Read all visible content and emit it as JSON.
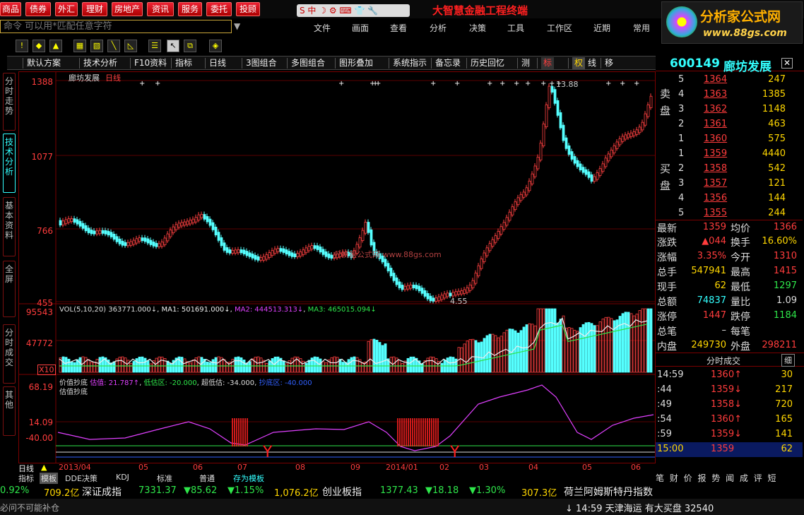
{
  "menu": {
    "buttons": [
      "商品",
      "债券",
      "外汇",
      "理财",
      "房地产",
      "资讯",
      "服务",
      "委托",
      "投顾"
    ],
    "title": "大智慧金融工程终端"
  },
  "cmd": {
    "text": "命令    可以用*匹配任意字符",
    "items": [
      "文件",
      "画面",
      "查看",
      "分析",
      "决策",
      "工具",
      "工作区",
      "近期",
      "常用"
    ]
  },
  "logo": {
    "name": "分析家公式网",
    "url": "www.88gs.com"
  },
  "tabs": [
    "默认方案",
    "技术分析",
    "F10资料",
    "指标",
    "日线",
    "3图组合",
    "多图组合",
    "图形叠加",
    "系统指示",
    "备忘录",
    "历史回忆",
    "测",
    "标",
    "权",
    "线",
    "移"
  ],
  "sidebar": [
    "分时走势",
    "技术分析",
    "基本资料",
    "全屏",
    "分时成交",
    "其他"
  ],
  "main_chart": {
    "title": "廊坊发展",
    "period": "日线",
    "watermark": "分析家公式网 www.88gs.com",
    "y_labels": [
      "1388",
      "1077",
      "766",
      "455"
    ],
    "high_note": "13.88",
    "low_note": "4.55"
  },
  "vol": {
    "header": "VOL(5,10,20)",
    "vol": "363771.000↓",
    "ma1": "MA1: 501691.000↓",
    "ma2": "MA2: 444513.313↓",
    "ma3": "MA3: 465015.094↓",
    "y_labels": [
      "95543",
      "47772"
    ],
    "unit": "X10"
  },
  "ind": {
    "name": "价值抄底",
    "sub": "估值抄底",
    "l1": "估值: 21.787↑",
    "l2": "低估区: -20.000",
    "l3": "超低估: -34.000",
    "l4": "抄底区: -40.000",
    "y_labels": [
      "68.19",
      "14.09",
      "-40.00"
    ]
  },
  "xaxis": {
    "period": "日线",
    "labels": [
      "2013/04",
      "05",
      "06",
      "07",
      "08",
      "09",
      "2014/01",
      "02",
      "03",
      "04",
      "05",
      "06"
    ]
  },
  "quote": {
    "code": "600149",
    "name": "廊坊发展",
    "asks": [
      [
        "5",
        "1364",
        "247"
      ],
      [
        "4",
        "1363",
        "1385"
      ],
      [
        "3",
        "1362",
        "1148"
      ],
      [
        "2",
        "1361",
        "463"
      ],
      [
        "1",
        "1360",
        "575"
      ]
    ],
    "bids": [
      [
        "1",
        "1359",
        "4440"
      ],
      [
        "2",
        "1358",
        "542"
      ],
      [
        "3",
        "1357",
        "121"
      ],
      [
        "4",
        "1356",
        "144"
      ],
      [
        "5",
        "1355",
        "244"
      ]
    ],
    "ask_label": "卖盘",
    "bid_label": "买盘",
    "stats": [
      [
        "最新",
        "1359",
        "均价",
        "1366"
      ],
      [
        "涨跌",
        "▲044",
        "换手",
        "16.60%"
      ],
      [
        "涨幅",
        "3.35%",
        "今开",
        "1310"
      ],
      [
        "总手",
        "547941",
        "最高",
        "1415"
      ],
      [
        "现手",
        "62",
        "最低",
        "1297"
      ],
      [
        "总额",
        "74837",
        "量比",
        "1.09"
      ],
      [
        "涨停",
        "1447",
        "跌停",
        "1184"
      ],
      [
        "总笔",
        "–",
        "每笔",
        ""
      ],
      [
        "内盘",
        "249730",
        "外盘",
        "298211"
      ]
    ],
    "ticks_title": "分时成交",
    "ticks_btn": "细",
    "ticks": [
      [
        "14:59",
        "1360↑",
        "30"
      ],
      [
        ":44",
        "1359↓",
        "217"
      ],
      [
        ":49",
        "1358↓",
        "720"
      ],
      [
        ":54",
        "1360↑",
        "165"
      ],
      [
        ":59",
        "1359↓",
        "141"
      ],
      [
        "15:00",
        "1359",
        "62"
      ]
    ]
  },
  "bottom_tabs": [
    "指标",
    "模板",
    "DDE决策",
    "KDJ",
    "标准",
    "普通",
    "存为模板"
  ],
  "ticker": {
    "t1": "0.92%",
    "t2": "709.2亿",
    "n1": "深证成指",
    "v1": "7331.37",
    "c1": "▼85.62",
    "p1": "▼1.15%",
    "a1": "1,076.2亿",
    "n2": "创业板指",
    "v2": "1377.43",
    "c2": "▼18.18",
    "p2": "▼1.30%",
    "a2": "307.3亿",
    "n3": "荷兰阿姆斯特丹指数"
  },
  "status": {
    "left": "必问不可能补仓",
    "news": "↓ 14:59 天津海运 有大买盘 32540",
    "right_tabs": "笔 财 价 报 势 闻 成 评 短"
  }
}
